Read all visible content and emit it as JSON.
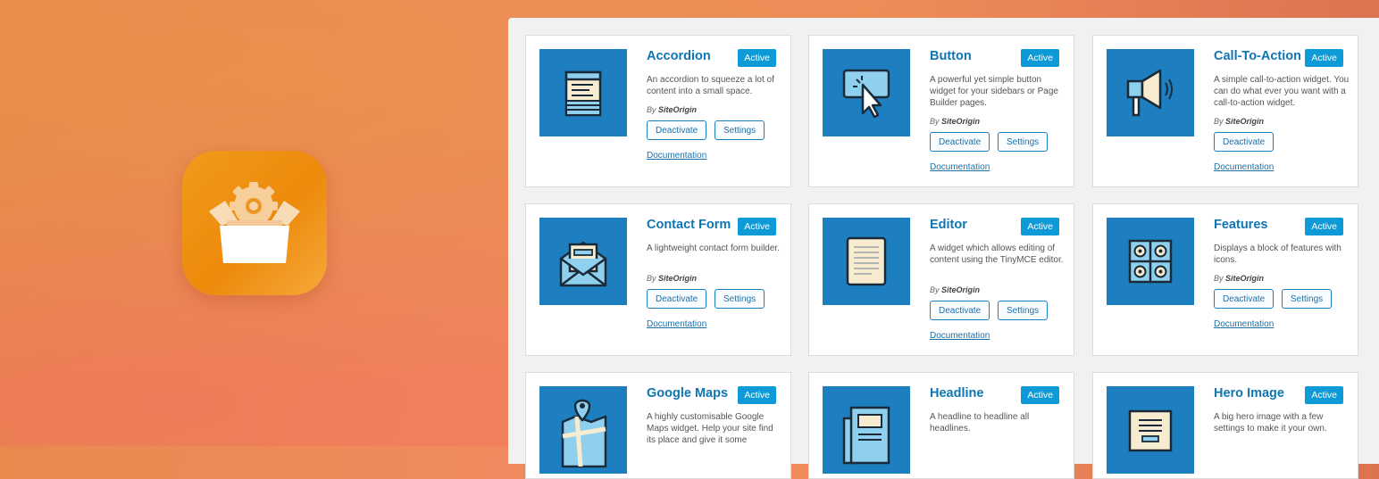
{
  "colors": {
    "accent": "#1d7fc0",
    "badge": "#0d9ad6",
    "title": "#0f75b3",
    "icon_bg": "#ed8a0c"
  },
  "app_icon": {
    "icon": "plugin-box-gear-icon"
  },
  "widgets": [
    {
      "title": "Accordion",
      "status": "Active",
      "icon": "accordion-icon",
      "description": "An accordion to squeeze a lot of content into a small space.",
      "author_prefix": "By",
      "author": "SiteOrigin",
      "deactivate": "Deactivate",
      "settings": "Settings",
      "documentation": "Documentation"
    },
    {
      "title": "Button",
      "status": "Active",
      "icon": "button-click-icon",
      "description": "A powerful yet simple button widget for your sidebars or Page Builder pages.",
      "author_prefix": "By",
      "author": "SiteOrigin",
      "deactivate": "Deactivate",
      "settings": "Settings",
      "documentation": "Documentation"
    },
    {
      "title": "Call-To-Action",
      "status": "Active",
      "icon": "megaphone-icon",
      "description": "A simple call-to-action widget. You can do what ever you want with a call-to-action widget.",
      "author_prefix": "By",
      "author": "SiteOrigin",
      "deactivate": "Deactivate",
      "documentation": "Documentation"
    },
    {
      "title": "Contact Form",
      "status": "Active",
      "icon": "envelope-icon",
      "description": "A lightweight contact form builder.",
      "author_prefix": "By",
      "author": "SiteOrigin",
      "deactivate": "Deactivate",
      "settings": "Settings",
      "documentation": "Documentation"
    },
    {
      "title": "Editor",
      "status": "Active",
      "icon": "document-icon",
      "description": "A widget which allows editing of content using the TinyMCE editor.",
      "author_prefix": "By",
      "author": "SiteOrigin",
      "deactivate": "Deactivate",
      "settings": "Settings",
      "documentation": "Documentation"
    },
    {
      "title": "Features",
      "status": "Active",
      "icon": "features-grid-icon",
      "description": "Displays a block of features with icons.",
      "author_prefix": "By",
      "author": "SiteOrigin",
      "deactivate": "Deactivate",
      "settings": "Settings",
      "documentation": "Documentation"
    },
    {
      "title": "Google Maps",
      "status": "Active",
      "icon": "map-pin-icon",
      "description": "A highly customisable Google Maps widget. Help your site find its place and give it some"
    },
    {
      "title": "Headline",
      "status": "Active",
      "icon": "newspaper-icon",
      "description": "A headline to headline all headlines."
    },
    {
      "title": "Hero Image",
      "status": "Active",
      "icon": "hero-image-icon",
      "description": "A big hero image with a few settings to make it your own."
    }
  ]
}
